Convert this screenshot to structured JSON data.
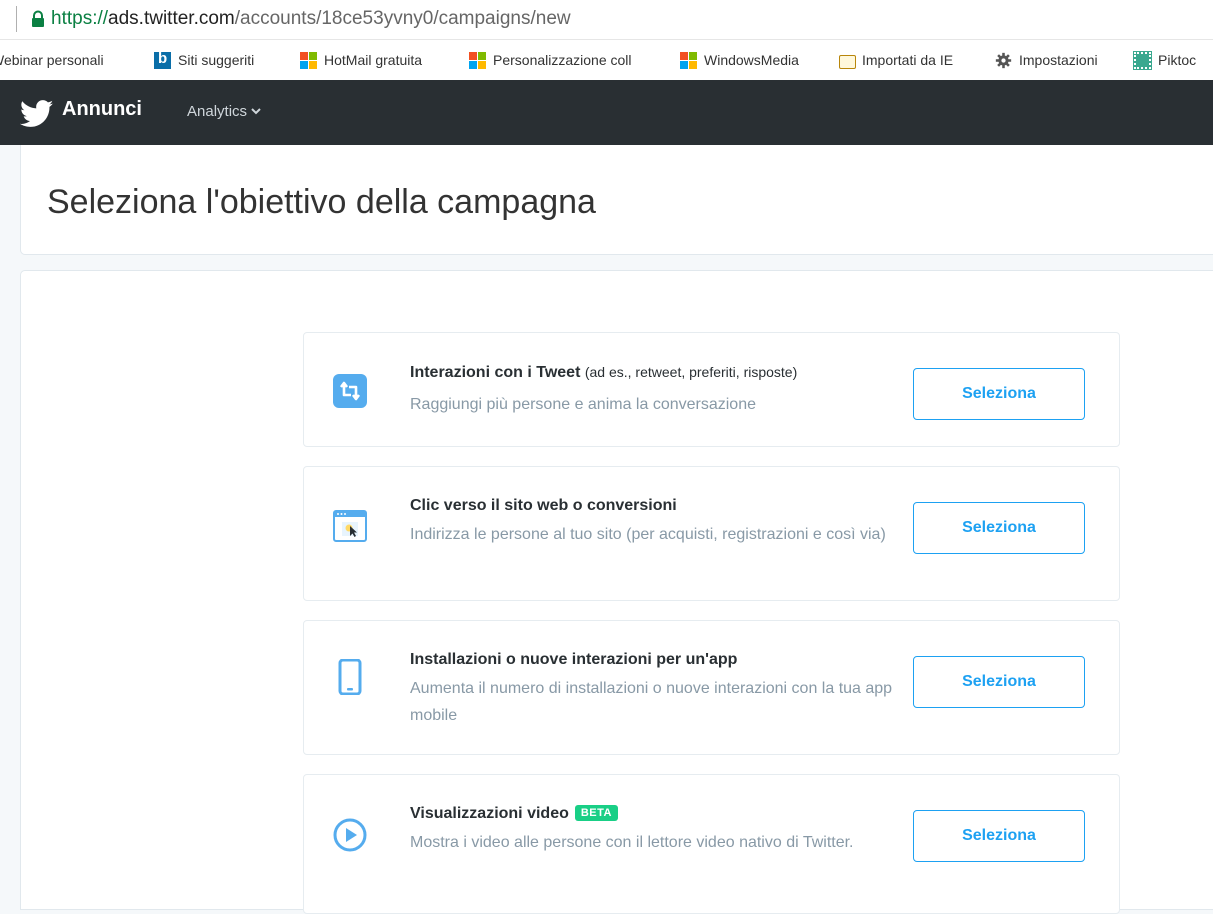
{
  "browser": {
    "url_scheme": "https://",
    "url_host": "ads.twitter.com",
    "url_path": "/accounts/18ce53yvny0/campaigns/new"
  },
  "bookmarks": [
    {
      "label": "Webinar personali",
      "icon": "none"
    },
    {
      "label": "Siti suggeriti",
      "icon": "bing-icon"
    },
    {
      "label": "HotMail gratuita",
      "icon": "windows-icon"
    },
    {
      "label": "Personalizzazione coll",
      "icon": "windows-icon"
    },
    {
      "label": "WindowsMedia",
      "icon": "windows-icon"
    },
    {
      "label": "Importati da IE",
      "icon": "folder-icon"
    },
    {
      "label": "Impostazioni",
      "icon": "gear-icon"
    },
    {
      "label": "Piktoc",
      "icon": "piktochart-icon"
    }
  ],
  "nav": {
    "brand": "Annunci",
    "analytics": "Analytics"
  },
  "page": {
    "title": "Seleziona l'obiettivo della campagna"
  },
  "objectives": [
    {
      "icon": "retweet-icon",
      "title": "Interazioni con i Tweet",
      "hint": "(ad es., retweet, preferiti, risposte)",
      "desc": "Raggiungi più persone e anima la conversazione",
      "button": "Seleziona"
    },
    {
      "icon": "website-click-icon",
      "title": "Clic verso il sito web o conversioni",
      "desc": "Indirizza le persone al tuo sito (per acquisti, registrazioni e così via)",
      "button": "Seleziona"
    },
    {
      "icon": "mobile-app-icon",
      "title": "Installazioni o nuove interazioni per un'app",
      "desc": "Aumenta il numero di installazioni o nuove interazioni con la tua app mobile",
      "button": "Seleziona"
    },
    {
      "icon": "video-play-icon",
      "title": "Visualizzazioni video",
      "badge": "BETA",
      "desc": "Mostra i video alle persone con il lettore video nativo di Twitter.",
      "button": "Seleziona"
    }
  ],
  "colors": {
    "accent": "#1da1f2",
    "nav_bg": "#292f33",
    "icon_blue": "#55acee",
    "beta_green": "#19cf86"
  }
}
